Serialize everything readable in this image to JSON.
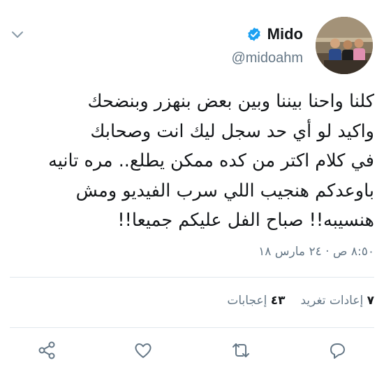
{
  "tweet": {
    "display_name": "Mido",
    "handle": "@midoahm",
    "text_lines": [
      "كلنا واحنا بيننا وبين بعض بنهزر وبنضحك",
      "واكيد لو أي حد سجل ليك انت وصحابك",
      "في كلام اكتر من كده ممكن يطلع.. مره تانيه",
      "باوعدكم هنجيب اللي سرب الفيديو ومش",
      "هنسيبه!! صباح الفل عليكم جميعا!!"
    ],
    "timestamp": "٨:٥٠ ص · ٢٤ مارس ١٨",
    "retweets_count": "٧",
    "retweets_label": "إعادات تغريد",
    "likes_count": "٤٣",
    "likes_label": "إعجابات"
  },
  "icons": {
    "menu": "chevron-down-icon",
    "verified": "verified-badge-icon",
    "share": "share-icon",
    "like": "heart-icon",
    "retweet": "retweet-icon",
    "reply": "reply-icon"
  },
  "colors": {
    "text": "#14171a",
    "secondary": "#657786",
    "verified": "#1da1f2",
    "divider": "#e1e8ed"
  }
}
